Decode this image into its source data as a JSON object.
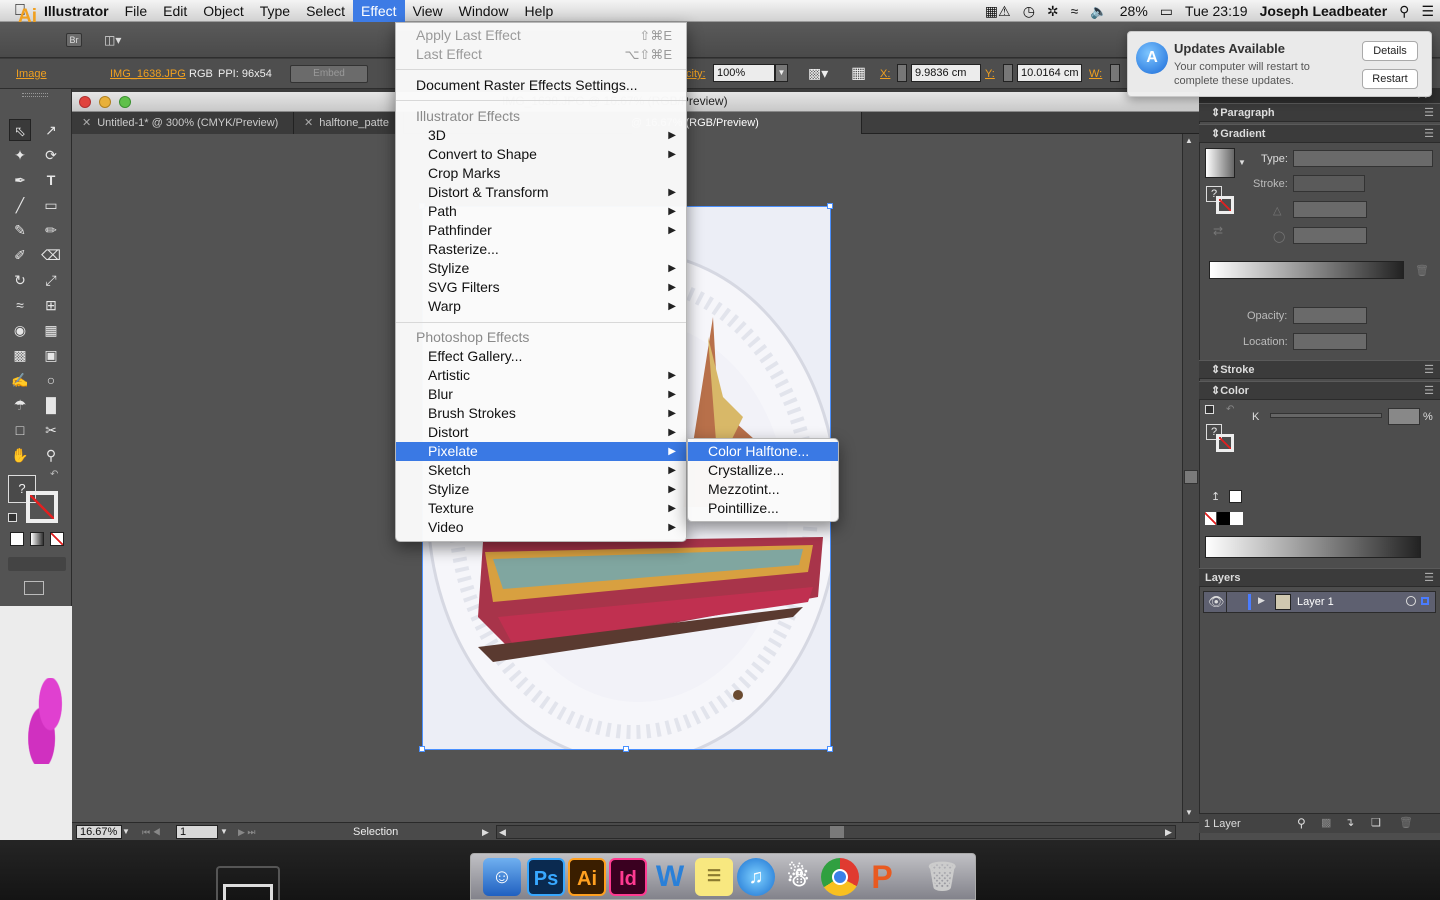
{
  "menubar": {
    "app_name": "Illustrator",
    "items": [
      "File",
      "Edit",
      "Object",
      "Type",
      "Select",
      "Effect",
      "View",
      "Window",
      "Help"
    ],
    "battery": "28%",
    "clock": "Tue 23:19",
    "user": "Joseph Leadbeater"
  },
  "appbar": {
    "logo": "Ai",
    "bridge": "Br"
  },
  "control_bar": {
    "object_type": "Image",
    "file_name": "IMG_1638.JPG",
    "color_mode": "RGB",
    "ppi": "PPI: 96x54",
    "embed_label": "Embed",
    "opacity_label": "Opacity:",
    "opacity_value": "100%",
    "x_label": "X:",
    "x_value": "9.9836 cm",
    "y_label": "Y:",
    "y_value": "10.0164 cm",
    "w_label": "W:"
  },
  "document": {
    "window_title": "IMG_1638.JPG @ 16.67% (RGB/Preview)",
    "tabs": [
      "Untitled-1* @ 300% (CMYK/Preview)",
      "halftone_patte",
      "IMG_1638.JPG @ 16.67% (RGB/Preview)"
    ],
    "zoom": "16.67%",
    "page": "1",
    "status": "Selection"
  },
  "effect_menu": {
    "apply_last": {
      "label": "Apply Last Effect",
      "shortcut": "⇧⌘E"
    },
    "last_effect": {
      "label": "Last Effect",
      "shortcut": "⌥⇧⌘E"
    },
    "doc_raster": "Document Raster Effects Settings...",
    "illustrator_header": "Illustrator Effects",
    "illustrator_items": [
      "3D",
      "Convert to Shape",
      "Crop Marks",
      "Distort & Transform",
      "Path",
      "Pathfinder",
      "Rasterize...",
      "Stylize",
      "SVG Filters",
      "Warp"
    ],
    "photoshop_header": "Photoshop Effects",
    "photoshop_items": [
      "Effect Gallery...",
      "Artistic",
      "Blur",
      "Brush Strokes",
      "Distort",
      "Pixelate",
      "Sketch",
      "Stylize",
      "Texture",
      "Video"
    ]
  },
  "pixelate_submenu": {
    "items": [
      "Color Halftone...",
      "Crystallize...",
      "Mezzotint...",
      "Pointillize..."
    ]
  },
  "notification": {
    "title": "Updates Available",
    "body_line1": "Your computer will restart to",
    "body_line2": "complete these updates.",
    "details_button": "Details",
    "restart_button": "Restart"
  },
  "panels": {
    "paragraph": "Paragraph",
    "gradient": "Gradient",
    "type_label": "Type:",
    "stroke_label": "Stroke:",
    "opacity_label": "Opacity:",
    "location_label": "Location:",
    "stroke": "Stroke",
    "color": "Color",
    "k_label": "K",
    "percent": "%",
    "layers": "Layers",
    "layer1": "Layer 1",
    "layer_count": "1 Layer"
  },
  "colors": {
    "accent_orange": "#f0a020",
    "menu_highlight": "#3a79e4",
    "selection_blue": "#4a90ff"
  }
}
